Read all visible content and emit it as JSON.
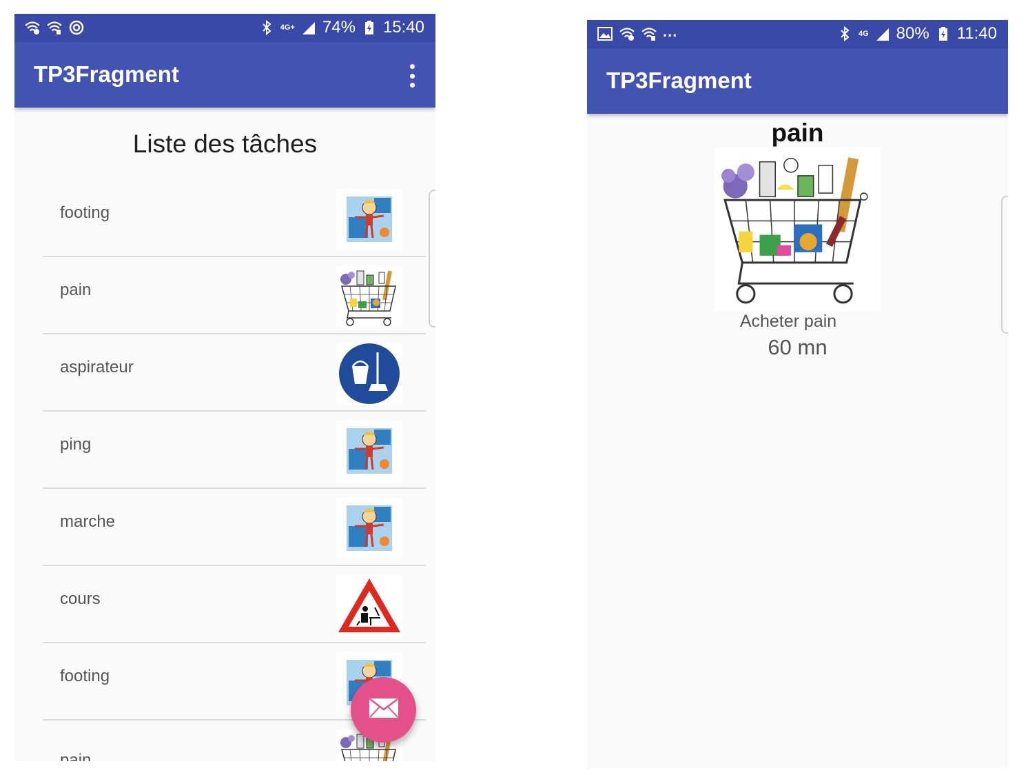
{
  "left_screen": {
    "statusbar": {
      "left_icons": [
        "wifi-question-icon",
        "wifi-question-icon",
        "sync-icon"
      ],
      "network": "4G+",
      "battery": "74%",
      "time": "15:40"
    },
    "appbar": {
      "title": "TP3Fragment",
      "menu_icon": "overflow-menu-icon"
    },
    "list_title": "Liste des tâches",
    "tasks": [
      {
        "label": "footing",
        "icon": "sport-child-icon"
      },
      {
        "label": "pain",
        "icon": "shopping-cart-icon"
      },
      {
        "label": "aspirateur",
        "icon": "cleaning-bucket-icon"
      },
      {
        "label": "ping",
        "icon": "sport-child-icon"
      },
      {
        "label": "marche",
        "icon": "sport-child-icon"
      },
      {
        "label": "cours",
        "icon": "warning-study-icon"
      },
      {
        "label": "footing",
        "icon": "sport-child-icon"
      },
      {
        "label": "pain",
        "icon": "shopping-cart-icon"
      }
    ],
    "fab": {
      "icon": "mail-icon"
    }
  },
  "right_screen": {
    "statusbar": {
      "left_icons": [
        "image-icon",
        "wifi-question-icon",
        "wifi-question-icon"
      ],
      "more": "...",
      "network": "4G",
      "battery": "80%",
      "time": "11:40"
    },
    "appbar": {
      "title": "TP3Fragment"
    },
    "detail": {
      "name": "pain",
      "image": "shopping-cart-icon",
      "description": "Acheter pain",
      "duration": "60 mn"
    }
  },
  "colors": {
    "statusbar": "#3849a8",
    "appbar": "#4253b2",
    "fab": "#e4508a",
    "background": "#fafafa"
  }
}
